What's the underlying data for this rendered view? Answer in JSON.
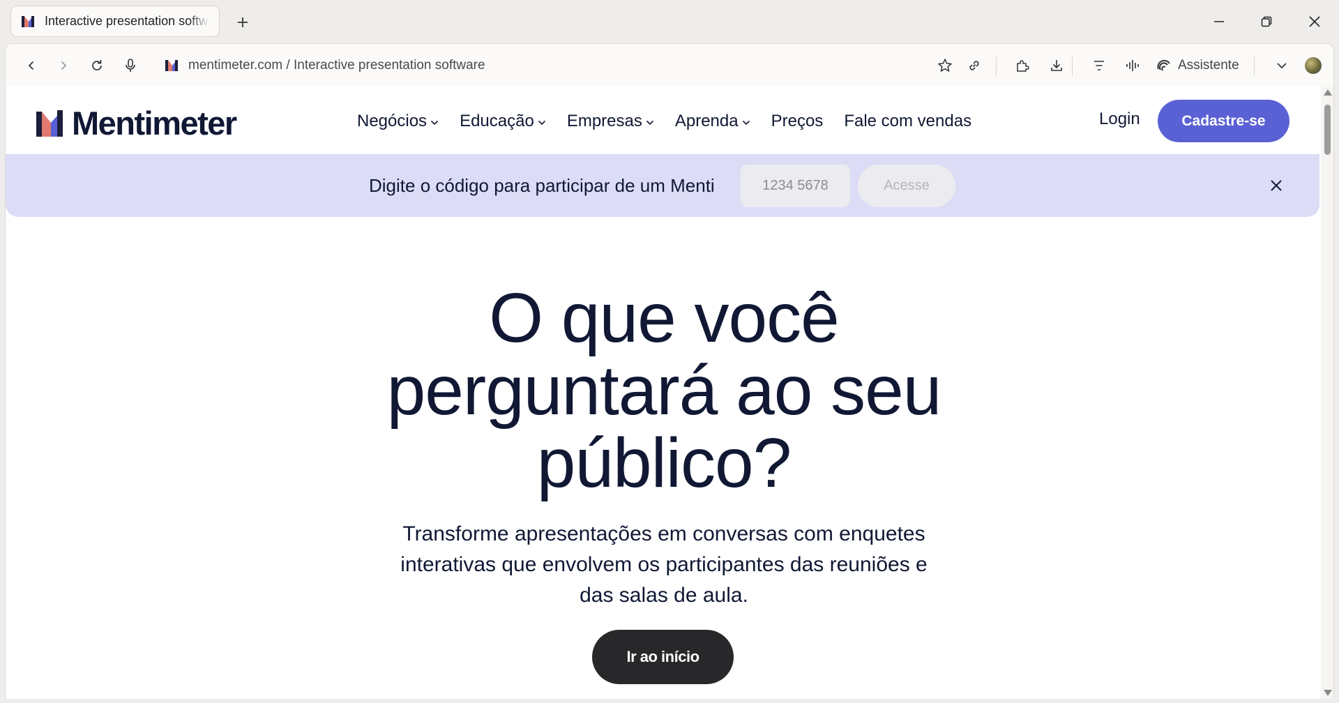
{
  "browser": {
    "tab_title": "Interactive presentation software",
    "url": "mentimeter.com / Interactive presentation software",
    "assistant_label": "Assistente",
    "icons": [
      "favicon-icon",
      "new-tab-icon",
      "minimize-icon",
      "restore-icon",
      "close-window-icon",
      "back-icon",
      "forward-icon",
      "reload-icon",
      "microphone-icon",
      "star-icon",
      "link-icon",
      "extensions-icon",
      "download-icon",
      "reader-icon",
      "audio-icon",
      "assistant-icon",
      "chevron-down-icon"
    ]
  },
  "site": {
    "logo_text": "Mentimeter",
    "nav": [
      {
        "label": "Negócios",
        "has_menu": true
      },
      {
        "label": "Educação",
        "has_menu": true
      },
      {
        "label": "Empresas",
        "has_menu": true
      },
      {
        "label": "Aprenda",
        "has_menu": true
      },
      {
        "label": "Preços",
        "has_menu": false
      },
      {
        "label": "Fale com vendas",
        "has_menu": false
      }
    ],
    "login_label": "Login",
    "signup_label": "Cadastre-se"
  },
  "banner": {
    "text": "Digite o código para participar de um Menti",
    "code_placeholder": "1234 5678",
    "access_label": "Acesse"
  },
  "hero": {
    "title_lines": [
      "O que você",
      "perguntará ao seu",
      "público?"
    ],
    "subtitle_lines": [
      "Transforme apresentações em conversas com enquetes",
      "interativas que envolvem os participantes das reuniões e",
      "das salas de aula."
    ],
    "cta_label": "Ir ao início"
  },
  "colors": {
    "brand_primary": "#5a61d4",
    "banner_bg": "#dcdcf6",
    "text_dark": "#101834",
    "cta_bg": "#28282a"
  }
}
